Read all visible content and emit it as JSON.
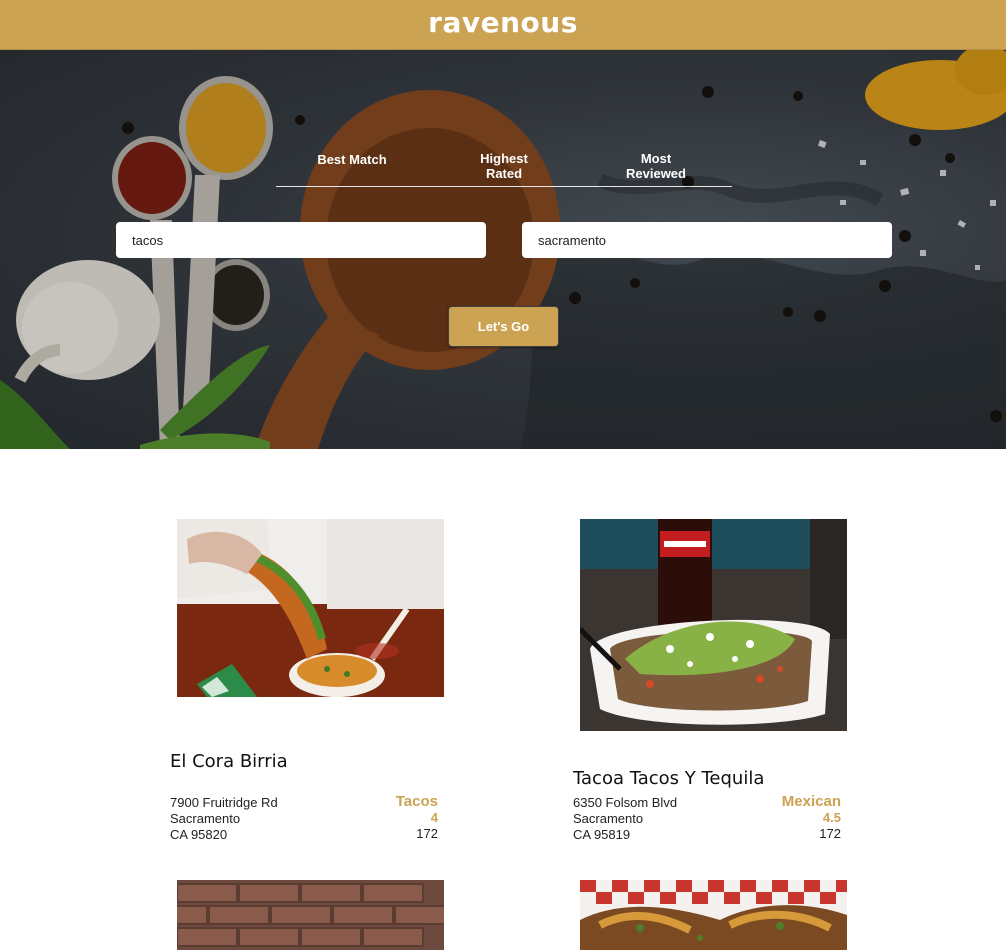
{
  "header": {
    "brand": "ravenous"
  },
  "hero": {
    "sort_options": [
      {
        "label": "Best Match"
      },
      {
        "label": "Highest\nRated"
      },
      {
        "label": "Most\nReviewed"
      }
    ],
    "search_term": {
      "value": "tacos"
    },
    "location": {
      "value": "sacramento"
    },
    "go_label": "Let's Go"
  },
  "results": [
    {
      "name": "El Cora Birria",
      "address": [
        "7900 Fruitridge Rd",
        "Sacramento",
        "CA 95820"
      ],
      "category": "Tacos",
      "rating": "4",
      "review_count": "172"
    },
    {
      "name": "Tacoa Tacos Y Tequila",
      "address": [
        "6350 Folsom Blvd",
        "Sacramento",
        "CA 95819"
      ],
      "category": "Mexican",
      "rating": "4.5",
      "review_count": "172"
    }
  ]
}
